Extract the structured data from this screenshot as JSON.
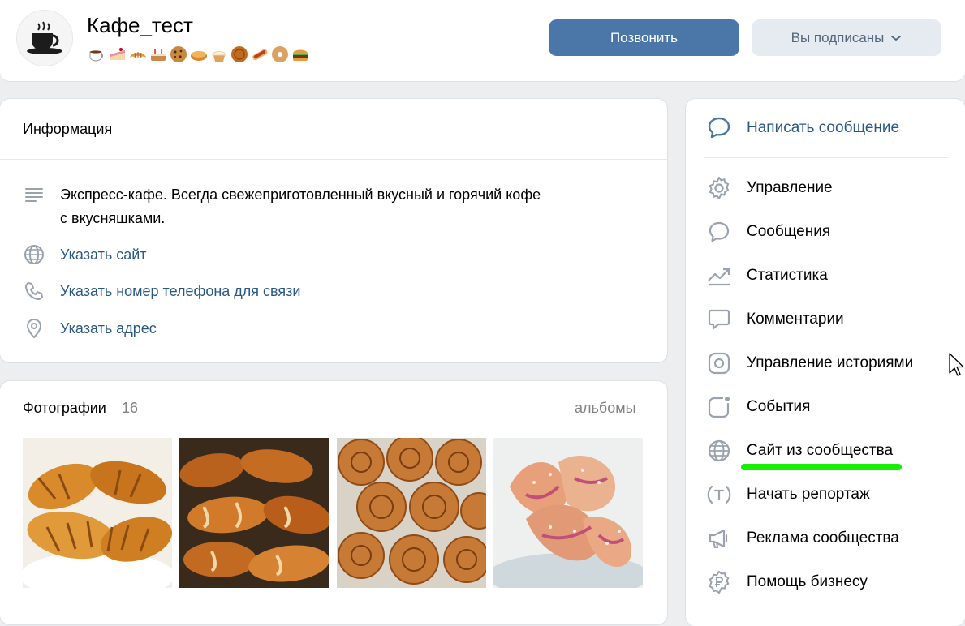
{
  "header": {
    "title": "Кафе_тест",
    "emoji_icons": [
      "coffee-emoji",
      "cake-slice-emoji",
      "croissant-emoji",
      "birthday-cake-emoji",
      "cookie-emoji",
      "pie-emoji",
      "cupcake-emoji",
      "mooncake-emoji",
      "hotdog-emoji",
      "bagel-emoji",
      "burger-emoji"
    ],
    "call_button": "Позвонить",
    "subscribed_button": "Вы подписаны"
  },
  "info": {
    "title": "Информация",
    "description": "Экспресс-кафе. Всегда свежеприготовленный вкусный и горячий кофе с вкусняшками.",
    "description_line1": "Экспресс-кафе. Всегда свежеприготовленный вкусный и горячий кофе",
    "description_line2": "с вкусняшками.",
    "website_link": "Указать сайт",
    "phone_link": "Указать номер телефона для связи",
    "address_link": "Указать адрес"
  },
  "photos": {
    "title": "Фотографии",
    "count": "16",
    "albums_link": "альбомы",
    "items": [
      "croissants-photo",
      "rolls-photo",
      "cinnamon-buns-photo",
      "sugar-pastries-photo"
    ]
  },
  "menu": {
    "write_message": "Написать сообщение",
    "items": [
      {
        "label": "Управление",
        "icon": "gear-icon"
      },
      {
        "label": "Сообщения",
        "icon": "chat-icon"
      },
      {
        "label": "Статистика",
        "icon": "chart-icon"
      },
      {
        "label": "Комментарии",
        "icon": "comment-icon"
      },
      {
        "label": "Управление историями",
        "icon": "stories-icon"
      },
      {
        "label": "События",
        "icon": "event-icon"
      },
      {
        "label": "Сайт из сообщества",
        "icon": "globe-icon"
      },
      {
        "label": "Начать репортаж",
        "icon": "broadcast-icon"
      },
      {
        "label": "Реклама сообщества",
        "icon": "megaphone-icon"
      },
      {
        "label": "Помощь бизнесу",
        "icon": "ruble-icon"
      }
    ]
  },
  "colors": {
    "accent": "#4a76a8",
    "link": "#2a5885",
    "highlight": "#14f000",
    "background": "#edeef0"
  }
}
